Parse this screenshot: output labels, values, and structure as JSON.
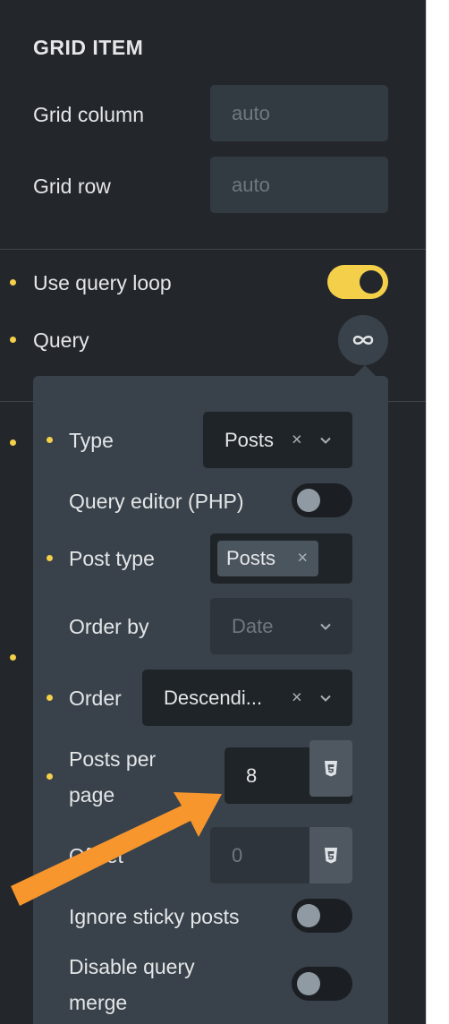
{
  "grid_item": {
    "title": "GRID ITEM",
    "grid_column": {
      "label": "Grid column",
      "placeholder": "auto"
    },
    "grid_row": {
      "label": "Grid row",
      "placeholder": "auto"
    }
  },
  "query_loop": {
    "use_query_loop": {
      "label": "Use query loop",
      "enabled": true
    },
    "query": {
      "label": "Query",
      "icon": "infinity-icon"
    }
  },
  "query_popup": {
    "type": {
      "label": "Type",
      "value": "Posts",
      "clear": "×"
    },
    "query_editor": {
      "label": "Query editor (PHP)",
      "enabled": false
    },
    "post_type": {
      "label": "Post type",
      "tag": "Posts",
      "clear": "×"
    },
    "order_by": {
      "label": "Order by",
      "placeholder": "Date"
    },
    "order": {
      "label": "Order",
      "value": "Descendi...",
      "clear": "×"
    },
    "posts_per_page": {
      "label_line1": "Posts per",
      "label_line2": "page",
      "value": "8",
      "icon": "css3-icon"
    },
    "offset": {
      "label": "Offset",
      "placeholder": "0",
      "icon": "css3-icon"
    },
    "ignore_sticky": {
      "label": "Ignore sticky posts",
      "enabled": false
    },
    "disable_merge": {
      "label_line1": "Disable query",
      "label_line2": "merge",
      "enabled": false
    }
  },
  "colors": {
    "panel_bg": "#23272c",
    "popup_bg": "#39424a",
    "accent_yellow": "#f3cf4a",
    "annotation_arrow": "#f7962d"
  }
}
